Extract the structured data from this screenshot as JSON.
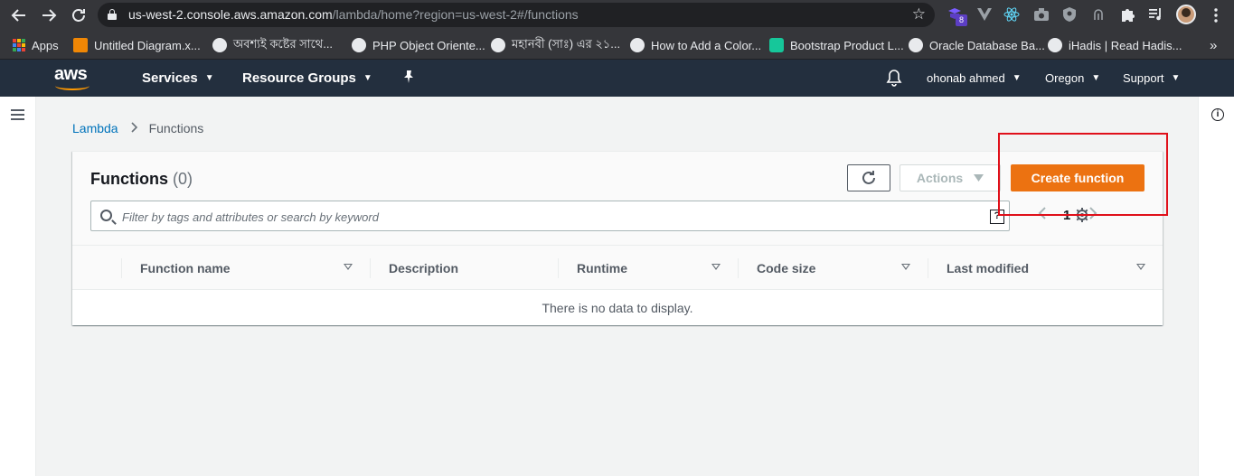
{
  "browser": {
    "url_host": "us-west-2.console.aws.amazon.com",
    "url_path": "/lambda/home?region=us-west-2#/functions",
    "extension_badge": "8",
    "bookmarks": [
      {
        "label": "Apps",
        "icon": "apps-grid-icon"
      },
      {
        "label": "Untitled Diagram.x...",
        "icon": "drawio-icon",
        "color": "#f08705"
      },
      {
        "label": "অবশ্যই কষ্টের সাথে...",
        "icon": "globe-icon",
        "color": "#e8eaed"
      },
      {
        "label": "PHP Object Oriente...",
        "icon": "wordpress-icon",
        "color": "#e8eaed"
      },
      {
        "label": "মহানবী (সাঃ) এর ২১...",
        "icon": "globe-icon",
        "color": "#e8eaed"
      },
      {
        "label": "How to Add a Color...",
        "icon": "globe-icon",
        "color": "#e8eaed"
      },
      {
        "label": "Bootstrap Product L...",
        "icon": "bootstrap-icon",
        "color": "#16c79a"
      },
      {
        "label": "Oracle Database Ba...",
        "icon": "globe-icon",
        "color": "#e8eaed"
      },
      {
        "label": "iHadis | Read Hadis...",
        "icon": "globe-icon",
        "color": "#e8eaed"
      }
    ],
    "bookmarks_overflow": "»"
  },
  "aws_nav": {
    "logo_text": "aws",
    "services": "Services",
    "resource_groups": "Resource Groups",
    "user": "ohonab ahmed",
    "region": "Oregon",
    "support": "Support"
  },
  "breadcrumb": {
    "root": "Lambda",
    "current": "Functions"
  },
  "panel": {
    "title": "Functions",
    "count": "(0)",
    "actions_label": "Actions",
    "create_label": "Create function",
    "search_placeholder": "Filter by tags and attributes or search by keyword",
    "page_number": "1",
    "columns": [
      "Function name",
      "Description",
      "Runtime",
      "Code size",
      "Last modified"
    ],
    "empty_message": "There is no data to display."
  },
  "colors": {
    "aws_nav_bg": "#232f3e",
    "primary_button": "#ec7211",
    "link": "#0073bb",
    "highlight_box": "#e0101a"
  }
}
